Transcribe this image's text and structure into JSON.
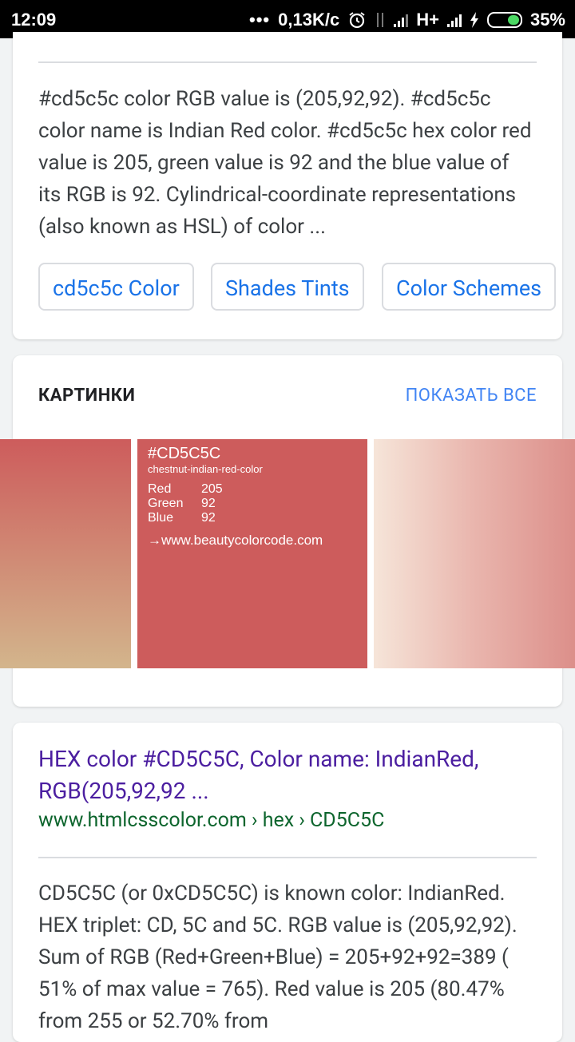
{
  "status_bar": {
    "time": "12:09",
    "speed": "0,13K/c",
    "network": "H+",
    "battery": "35%",
    "icons": [
      "more-dots-icon",
      "alarm-icon",
      "data-arrows-icon",
      "signal-icon",
      "signal-icon",
      "charging-icon",
      "battery-icon"
    ]
  },
  "result1": {
    "snippet": "#cd5c5c color RGB value is (205,92,92). #cd5c5c color name is Indian Red color. #cd5c5c hex color red value is 205, green value is 92 and the blue value of its RGB is 92. Cylindrical-coordinate representations (also known as HSL) of color ...",
    "chips": [
      "cd5c5c Color",
      "Shades Tints",
      "Color Schemes"
    ]
  },
  "images": {
    "title": "КАРТИНКИ",
    "show_all": "ПОКАЗАТЬ ВСЕ",
    "image2": {
      "hex": "#CD5C5C",
      "subtitle": "chestnut-indian-red-color",
      "rows": [
        {
          "label": "Red",
          "value": "205"
        },
        {
          "label": "Green",
          "value": "92"
        },
        {
          "label": "Blue",
          "value": "92"
        }
      ],
      "url": "→www.beautycolorcode.com"
    }
  },
  "result2": {
    "title": "HEX color #CD5C5C, Color name: IndianRed, RGB(205,92,92 ...",
    "url": "www.htmlcsscolor.com › hex › CD5C5C",
    "snippet": "CD5C5C (or 0xCD5C5C) is known color: IndianRed. HEX triplet: CD, 5C and 5C. RGB value is (205,92,92). Sum of RGB (Red+Green+Blue) = 205+92+92=389 ( 51% of max value = 765). Red value is 205 (80.47% from 255 or 52.70% from"
  },
  "colors": {
    "link": "#1a73e8",
    "title": "#4b1ea0",
    "url": "#0d652d",
    "swatch": "#cd5c5c"
  }
}
